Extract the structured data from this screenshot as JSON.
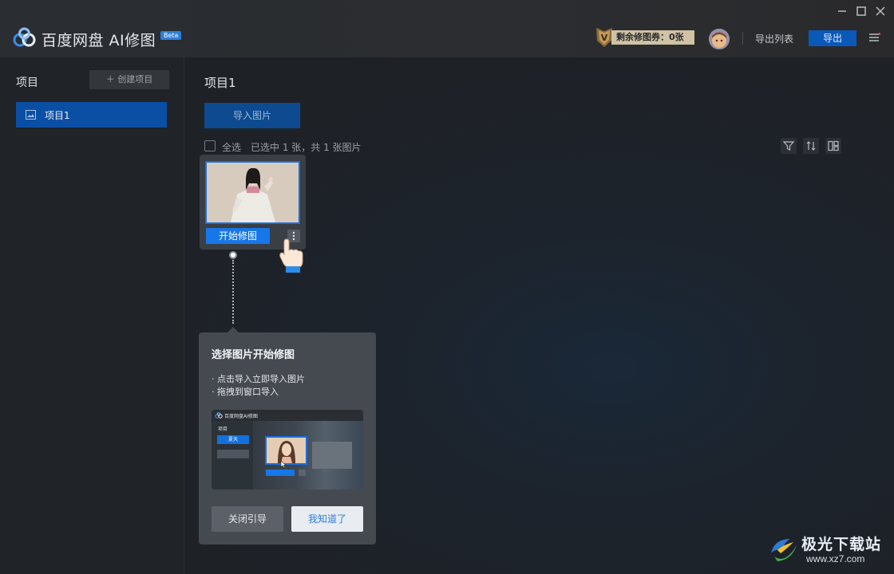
{
  "app": {
    "name": "百度网盘 AI修图",
    "badge": "Beta"
  },
  "header": {
    "coupon_label": "剩余修图券：0张",
    "coupon_icon": "v-badge-icon",
    "export_list_label": "导出列表",
    "export_label": "导出"
  },
  "sidebar": {
    "title": "项目",
    "create_label": "＋ 创建项目",
    "items": [
      {
        "label": "项目1",
        "selected": true
      }
    ]
  },
  "main": {
    "title": "项目1",
    "import_label": "导入图片",
    "select_all_label": "全选",
    "selection_info": "已选中 1 张，共 1 张图片",
    "card": {
      "start_label": "开始修图"
    }
  },
  "guide": {
    "title": "选择图片开始修图",
    "lines": [
      "· 点击导入立即导入图片",
      "· 拖拽到窗口导入"
    ],
    "preview": {
      "app_name": "百度网盘AI修图",
      "sidebar_title": "项目",
      "sidebar_item": "夏天"
    },
    "close_label": "关闭引导",
    "ok_label": "我知道了"
  },
  "watermark": {
    "text": "极光下载站",
    "url": "www.xz7.com"
  },
  "colors": {
    "accent": "#1677e8",
    "selected_item": "#0a4fa4",
    "coupon_bg": "#cfc2a5"
  }
}
